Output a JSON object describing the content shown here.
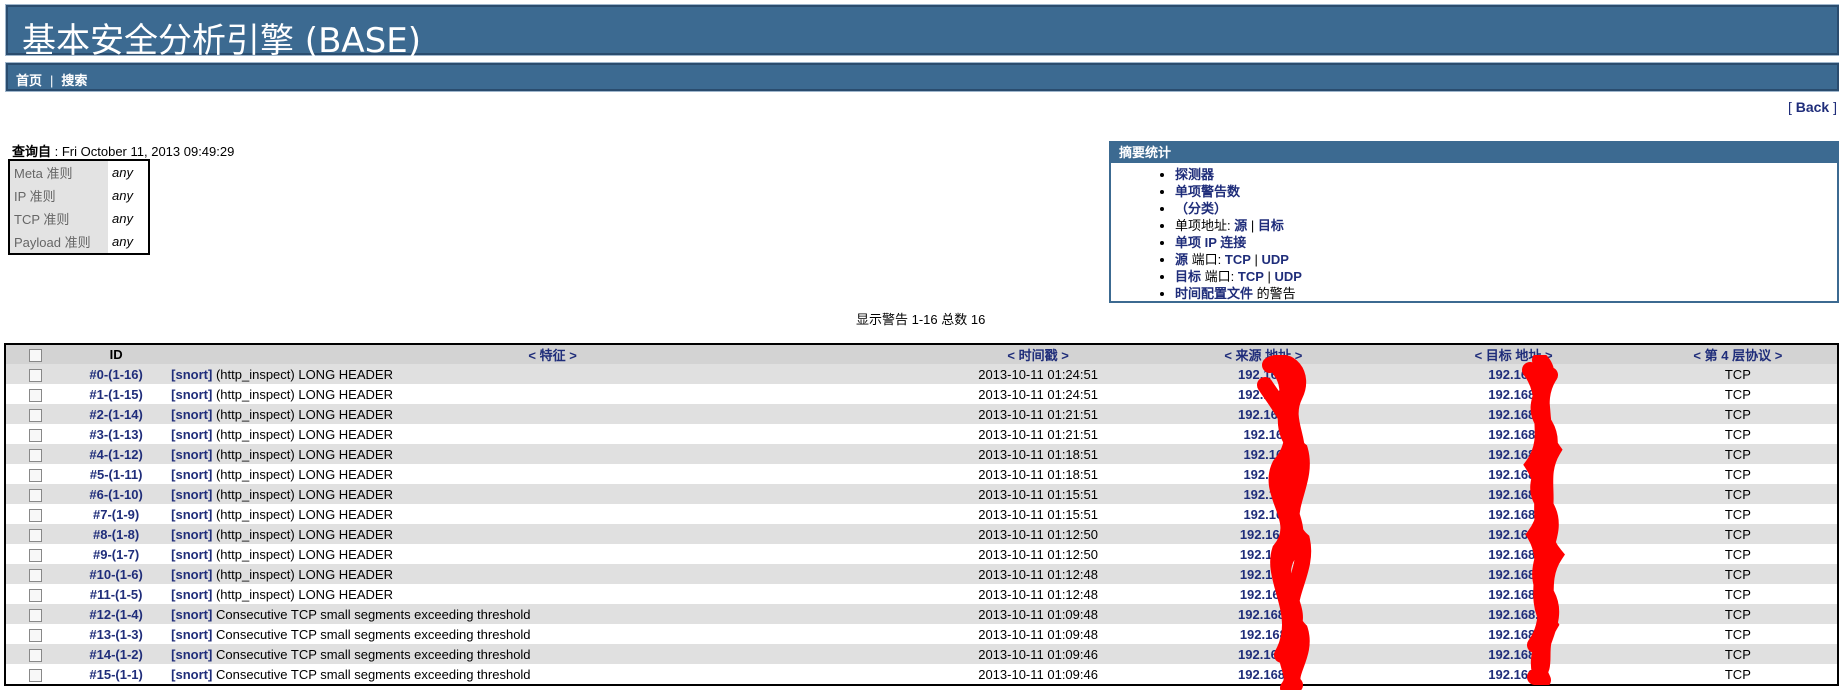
{
  "header": {
    "title": "基本安全分析引擎 (BASE)"
  },
  "nav": {
    "home": "首页",
    "separator": "|",
    "search": "搜索"
  },
  "back": {
    "open": "[",
    "label": "Back",
    "close": "]"
  },
  "query": {
    "label": "查询自",
    "value": ": Fri October 11, 2013 09:49:29"
  },
  "criteria": [
    {
      "key": "Meta 准则",
      "value": "any"
    },
    {
      "key": "IP 准则",
      "value": "any"
    },
    {
      "key": "TCP 准则",
      "value": "any"
    },
    {
      "key": "Payload 准则",
      "value": "any"
    }
  ],
  "summary": {
    "title": "摘要统计",
    "sensors": "探测器",
    "unique_alerts": "单项警告数",
    "categories": "（分类）",
    "unique_addr_label": "单项地址:",
    "src": "源",
    "pipe": "|",
    "dst": "目标",
    "unique_ip_links": "单项 IP 连接",
    "src_port_label": "源",
    "port_word": "端口:",
    "tcp": "TCP",
    "udp": "UDP",
    "dst_port_label": "目标",
    "time_profile": "时间配置文件",
    "time_profile_suffix": "的警告"
  },
  "display": {
    "text": "显示警告 1-16 总数 16"
  },
  "table": {
    "headers": {
      "id": "ID",
      "signature": "< 特征 >",
      "timestamp": "< 时间戳 >",
      "src": "< 来源 地址 >",
      "dst": "< 目标 地址 >",
      "proto": "< 第 4 层协议 >"
    },
    "rows": [
      {
        "id": "#0-(1-16)",
        "tag": "[snort]",
        "sig": "(http_inspect) LONG HEADER",
        "ts": "2013-10-11 01:24:51",
        "src": "192.168.",
        "dst": "192.168.",
        "proto": "TCP"
      },
      {
        "id": "#1-(1-15)",
        "tag": "[snort]",
        "sig": "(http_inspect) LONG HEADER",
        "ts": "2013-10-11 01:24:51",
        "src": "192.168.",
        "dst": "192.168.",
        "proto": "TCP"
      },
      {
        "id": "#2-(1-14)",
        "tag": "[snort]",
        "sig": "(http_inspect) LONG HEADER",
        "ts": "2013-10-11 01:21:51",
        "src": "192.168.",
        "dst": "192.168.",
        "proto": "TCP"
      },
      {
        "id": "#3-(1-13)",
        "tag": "[snort]",
        "sig": "(http_inspect) LONG HEADER",
        "ts": "2013-10-11 01:21:51",
        "src": "192.16",
        "dst": "192.168.",
        "proto": "TCP"
      },
      {
        "id": "#4-(1-12)",
        "tag": "[snort]",
        "sig": "(http_inspect) LONG HEADER",
        "ts": "2013-10-11 01:18:51",
        "src": "192.16",
        "dst": "192.168.",
        "proto": "TCP"
      },
      {
        "id": "#5-(1-11)",
        "tag": "[snort]",
        "sig": "(http_inspect) LONG HEADER",
        "ts": "2013-10-11 01:18:51",
        "src": "192.16",
        "dst": "192.168.",
        "proto": "TCP"
      },
      {
        "id": "#6-(1-10)",
        "tag": "[snort]",
        "sig": "(http_inspect) LONG HEADER",
        "ts": "2013-10-11 01:15:51",
        "src": "192.16",
        "dst": "192.168.",
        "proto": "TCP"
      },
      {
        "id": "#7-(1-9)",
        "tag": "[snort]",
        "sig": "(http_inspect) LONG HEADER",
        "ts": "2013-10-11 01:15:51",
        "src": "192.16",
        "dst": "192.168.",
        "proto": "TCP"
      },
      {
        "id": "#8-(1-8)",
        "tag": "[snort]",
        "sig": "(http_inspect) LONG HEADER",
        "ts": "2013-10-11 01:12:50",
        "src": "192.168",
        "dst": "192.168.",
        "proto": "TCP"
      },
      {
        "id": "#9-(1-7)",
        "tag": "[snort]",
        "sig": "(http_inspect) LONG HEADER",
        "ts": "2013-10-11 01:12:50",
        "src": "192.168",
        "dst": "192.168.",
        "proto": "TCP"
      },
      {
        "id": "#10-(1-6)",
        "tag": "[snort]",
        "sig": "(http_inspect) LONG HEADER",
        "ts": "2013-10-11 01:12:48",
        "src": "192.168",
        "dst": "192.168.",
        "proto": "TCP"
      },
      {
        "id": "#11-(1-5)",
        "tag": "[snort]",
        "sig": "(http_inspect) LONG HEADER",
        "ts": "2013-10-11 01:12:48",
        "src": "192.168",
        "dst": "192.168.",
        "proto": "TCP"
      },
      {
        "id": "#12-(1-4)",
        "tag": "[snort]",
        "sig": "Consecutive TCP small segments exceeding threshold",
        "ts": "2013-10-11 01:09:48",
        "src": "192.168.",
        "dst": "192.168.",
        "proto": "TCP"
      },
      {
        "id": "#13-(1-3)",
        "tag": "[snort]",
        "sig": "Consecutive TCP small segments exceeding threshold",
        "ts": "2013-10-11 01:09:48",
        "src": "192.168",
        "dst": "192.168.",
        "proto": "TCP"
      },
      {
        "id": "#14-(1-2)",
        "tag": "[snort]",
        "sig": "Consecutive TCP small segments exceeding threshold",
        "ts": "2013-10-11 01:09:46",
        "src": "192.168.",
        "dst": "192.168.",
        "proto": "TCP"
      },
      {
        "id": "#15-(1-1)",
        "tag": "[snort]",
        "sig": "Consecutive TCP small segments exceeding threshold",
        "ts": "2013-10-11 01:09:46",
        "src": "192.168.",
        "dst": "192.168.",
        "proto": "TCP"
      }
    ]
  },
  "colors": {
    "banner": "#3c6a91",
    "link": "#1f2d7a",
    "row_alt": "#e0e0e0",
    "redaction": "#ff0000"
  }
}
